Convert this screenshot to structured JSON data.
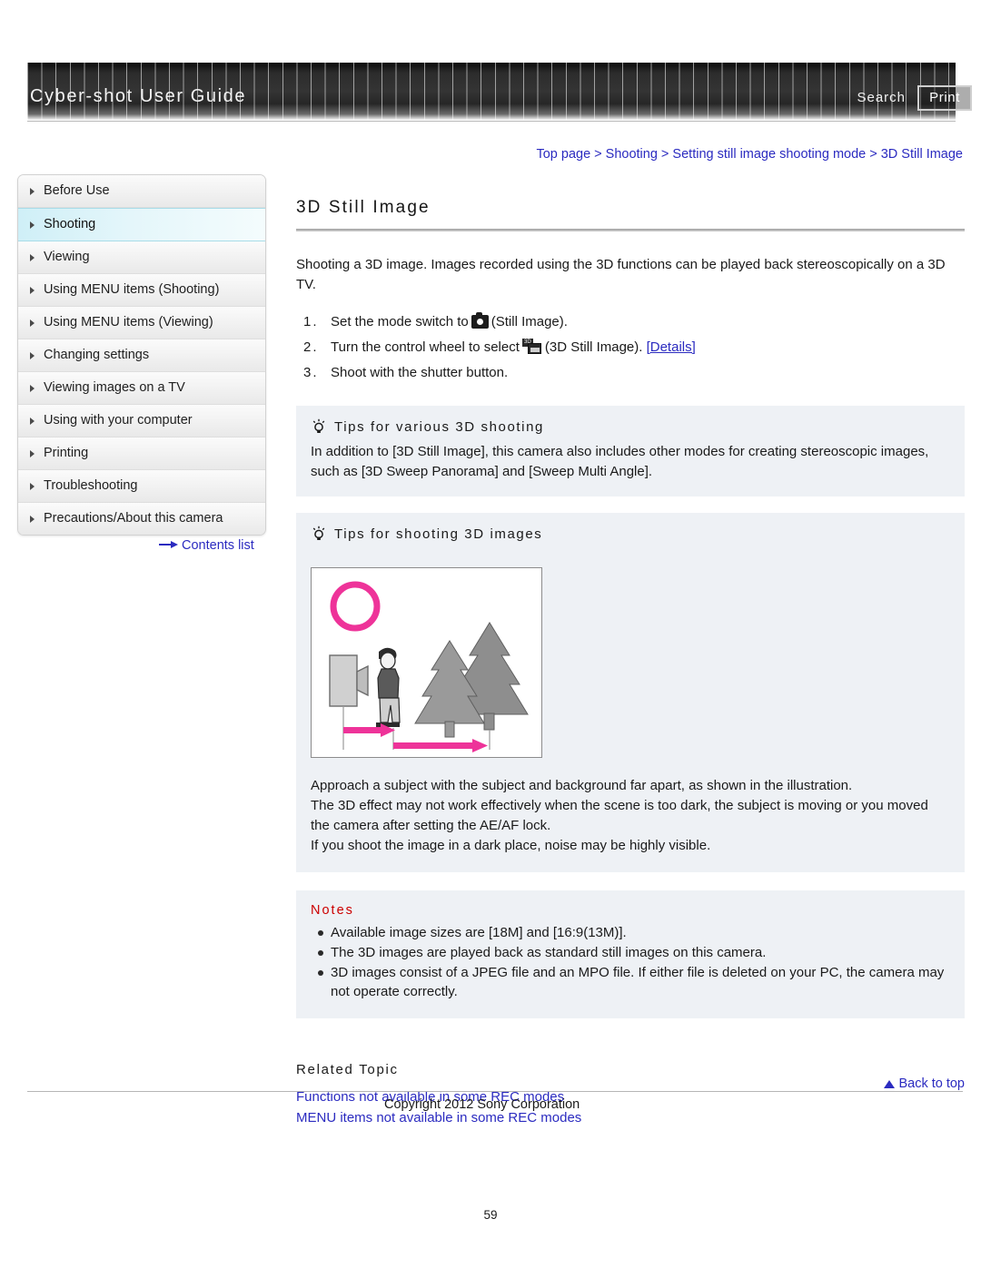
{
  "header": {
    "title": "Cyber-shot User Guide",
    "search_label": "Search",
    "print_label": "Print"
  },
  "breadcrumb": {
    "full": "Top page > Shooting > Setting still image shooting mode > 3D Still Image",
    "items": [
      "Top page",
      "Shooting",
      "Setting still image shooting mode",
      "3D Still Image"
    ]
  },
  "sidebar": {
    "items": [
      {
        "label": "Before Use",
        "selected": false
      },
      {
        "label": "Shooting",
        "selected": true
      },
      {
        "label": "Viewing",
        "selected": false
      },
      {
        "label": "Using MENU items (Shooting)",
        "selected": false
      },
      {
        "label": "Using MENU items (Viewing)",
        "selected": false
      },
      {
        "label": "Changing settings",
        "selected": false
      },
      {
        "label": "Viewing images on a TV",
        "selected": false
      },
      {
        "label": "Using with your computer",
        "selected": false
      },
      {
        "label": "Printing",
        "selected": false
      },
      {
        "label": "Troubleshooting",
        "selected": false
      },
      {
        "label": "Precautions/About this camera",
        "selected": false
      }
    ],
    "contents_list_label": "Contents list"
  },
  "main": {
    "title": "3D Still Image",
    "intro": "Shooting a 3D image. Images recorded using the 3D functions can be played back stereoscopically on a 3D TV.",
    "steps": [
      {
        "num": "1.",
        "text_before": "Set the mode switch to",
        "icon": "camera-icon",
        "text_after": "(Still Image).",
        "link": ""
      },
      {
        "num": "2.",
        "text_before": "Turn the control wheel to select",
        "icon": "3d-still-image-icon",
        "text_after": "(3D Still Image).",
        "link": "[Details]"
      },
      {
        "num": "3.",
        "text_before": "Shoot with the shutter button.",
        "icon": "",
        "text_after": "",
        "link": ""
      }
    ],
    "tips_1": {
      "icon": "lightbulb-icon",
      "heading": "Tips for various 3D shooting",
      "body": "In addition to [3D Still Image], this camera also includes other modes for creating stereoscopic images, such as [3D Sweep Panorama] and [Sweep Multi Angle]."
    },
    "tips_2": {
      "icon": "lightbulb-icon",
      "heading": "Tips for shooting 3D images",
      "description_lines": [
        "Approach a subject with the subject and background far apart, as shown in the illustration.",
        "The 3D effect may not work effectively when the scene is too dark, the subject is moving or you moved the camera after setting the AE/AF lock.",
        "If you shoot the image in a dark place, noise may be highly visible."
      ]
    },
    "notes": {
      "heading": "Notes",
      "items": [
        "Available image sizes are [18M] and [16:9(13M)].",
        "The 3D images are played back as standard still images on this camera.",
        "3D images consist of a JPEG file and an MPO file. If either file is deleted on your PC, the camera may not operate correctly."
      ]
    },
    "related": {
      "heading": "Related Topic",
      "links": [
        "Functions not available in some REC modes",
        "MENU items not available in some REC modes"
      ]
    }
  },
  "footer": {
    "back_to_top": "Back to top",
    "copyright": "Copyright 2012 Sony Corporation",
    "page_number": "59"
  },
  "colors": {
    "link": "#2b2bc0",
    "notes_heading": "#cc0000",
    "panel_bg": "#eef1f5",
    "sidebar_selected": "#cfeff7",
    "illustration_accent": "#ee3399"
  }
}
